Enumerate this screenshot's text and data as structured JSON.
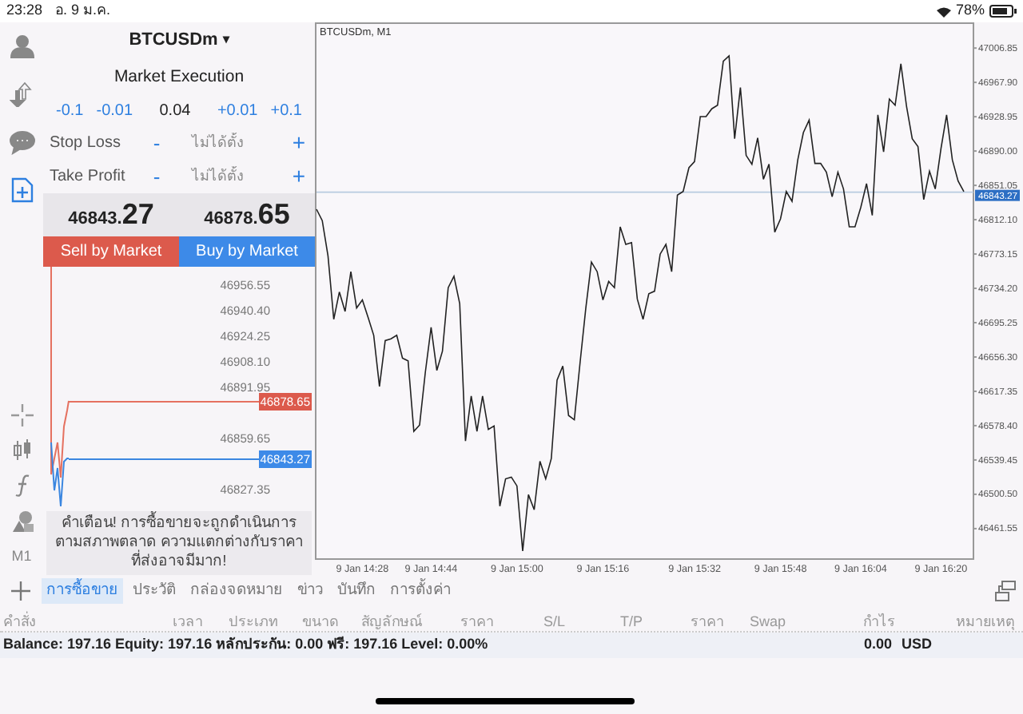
{
  "status_bar": {
    "time": "23:28",
    "date": "อ. 9 ม.ค.",
    "battery": "78%"
  },
  "sidebar": [
    {
      "selected": false
    },
    {
      "selected": false
    },
    {
      "selected": false
    },
    {
      "selected": true
    }
  ],
  "timeframe": "M1",
  "order_panel": {
    "symbol": "BTCUSDm",
    "symbol_caret": "▾",
    "execution": "Market Execution",
    "volume": {
      "steps_down": [
        "-0.1",
        "-0.01"
      ],
      "value": "0.04",
      "steps_up": [
        "+0.01",
        "+0.1"
      ]
    },
    "levels": [
      {
        "label": "Stop Loss",
        "minus": "-",
        "placeholder": "ไม่ได้ตั้ง",
        "plus": "+"
      },
      {
        "label": "Take Profit",
        "minus": "-",
        "placeholder": "ไม่ได้ตั้ง",
        "plus": "+"
      }
    ],
    "bid": "46843.27",
    "ask": "46878.65",
    "buttons": [
      {
        "label": "Sell by Market",
        "kind": "sell"
      },
      {
        "label": "Buy by Market",
        "kind": "buy"
      }
    ],
    "mini_chart": {
      "price_labels": [
        "46956.55",
        "46940.40",
        "46924.25",
        "46908.10",
        "46891.95",
        "46859.65",
        "46827.35"
      ],
      "ask_tag": "46878.65",
      "bid_tag": "46843.27"
    },
    "warning": "คำเตือน! การซื้อขายจะถูกดำเนินการตามสภาพตลาด ความแตกต่างกับราคาที่ส่งอาจมีมาก!"
  },
  "chart": {
    "chart_data": {
      "type": "line",
      "ref_lines": [
        {
          "axis": "y",
          "value": 46843.27,
          "label": "46843.27"
        }
      ],
      "title": "BTCUSDm, M1",
      "ylim": [
        46427,
        47036
      ],
      "yticks": [
        {
          "value": 47006.85,
          "label": "47006.85"
        },
        {
          "value": 46967.9,
          "label": "46967.90"
        },
        {
          "value": 46928.95,
          "label": "46928.95"
        },
        {
          "value": 46890,
          "label": "46890.00"
        },
        {
          "value": 46851.05,
          "label": "46851.05"
        },
        {
          "value": 46812.1,
          "label": "46812.10"
        },
        {
          "value": 46773.15,
          "label": "46773.15"
        },
        {
          "value": 46734.2,
          "label": "46734.20"
        },
        {
          "value": 46695.25,
          "label": "46695.25"
        },
        {
          "value": 46656.3,
          "label": "46656.30"
        },
        {
          "value": 46617.35,
          "label": "46617.35"
        },
        {
          "value": 46578.4,
          "label": "46578.40"
        },
        {
          "value": 46539.45,
          "label": "46539.45"
        },
        {
          "value": 46500.5,
          "label": "46500.50"
        },
        {
          "value": 46461.55,
          "label": "46461.55"
        }
      ],
      "categories": [
        null,
        null,
        null,
        null,
        null,
        null,
        null,
        null,
        "9 Jan 14:28",
        null,
        null,
        null,
        null,
        null,
        null,
        null,
        null,
        null,
        null,
        null,
        "9 Jan 14:44",
        null,
        null,
        null,
        null,
        null,
        null,
        null,
        null,
        null,
        null,
        null,
        null,
        null,
        null,
        "9 Jan 15:00",
        null,
        null,
        null,
        null,
        null,
        null,
        null,
        null,
        null,
        null,
        null,
        null,
        null,
        null,
        "9 Jan 15:16",
        null,
        null,
        null,
        null,
        null,
        null,
        null,
        null,
        null,
        null,
        null,
        null,
        null,
        null,
        null,
        "9 Jan 15:32",
        null,
        null,
        null,
        null,
        null,
        null,
        null,
        null,
        null,
        null,
        null,
        null,
        null,
        null,
        "9 Jan 15:48",
        null,
        null,
        null,
        null,
        null,
        null,
        null,
        null,
        null,
        null,
        null,
        null,
        null,
        "9 Jan 16:04",
        null,
        null,
        null,
        null,
        null,
        null,
        null,
        null,
        null,
        null,
        null,
        null,
        null,
        "9 Jan 16:20",
        null,
        null,
        null,
        null
      ],
      "series": [
        {
          "color": "#222222",
          "values": [
            46824,
            46811,
            46771,
            46699,
            46730,
            46708,
            46753,
            46712,
            46721,
            46701,
            46681,
            46623,
            46675,
            46677,
            46681,
            46655,
            46652,
            46572,
            46579,
            46639,
            46690,
            46641,
            46663,
            46735,
            46748,
            46717,
            46561,
            46612,
            46572,
            46612,
            46574,
            46578,
            46487,
            46518,
            46520,
            46510,
            46436,
            46500,
            46483,
            46538,
            46518,
            46541,
            46630,
            46646,
            46590,
            46585,
            46650,
            46712,
            46764,
            46753,
            46721,
            46742,
            46735,
            46804,
            46784,
            46786,
            46722,
            46699,
            46728,
            46731,
            46773,
            46784,
            46753,
            46840,
            46844,
            46871,
            46878,
            46929,
            46929,
            46938,
            46942,
            46992,
            46998,
            46904,
            46962,
            46885,
            46875,
            46905,
            46858,
            46875,
            46798,
            46813,
            46844,
            46833,
            46880,
            46911,
            46925,
            46876,
            46876,
            46866,
            46838,
            46866,
            46847,
            46804,
            46804,
            46826,
            46853,
            46817,
            46931,
            46889,
            46949,
            46942,
            46989,
            46940,
            46904,
            46895,
            46835,
            46867,
            46847,
            46893,
            46931,
            46880,
            46856,
            46844
          ]
        }
      ]
    }
  },
  "tabs": [
    {
      "label": "การซื้อขาย",
      "selected": true
    },
    {
      "label": "ประวัติ",
      "selected": false
    },
    {
      "label": "กล่องจดหมาย",
      "selected": false
    },
    {
      "label": "ข่าว",
      "selected": false
    },
    {
      "label": "บันทึก",
      "selected": false
    },
    {
      "label": "การตั้งค่า",
      "selected": false
    }
  ],
  "table": {
    "columns": [
      "คำสั่ง",
      "เวลา",
      "ประเภท",
      "ขนาด",
      "สัญลักษณ์",
      "ราคา",
      "S/L",
      "T/P",
      "ราคา",
      "Swap",
      "กำไร",
      "หมายเหตุ"
    ]
  },
  "summary": {
    "text": "Balance: 197.16 Equity: 197.16 หลักประกัน: 0.00 ฟรี: 197.16 Level: 0.00%",
    "profit": "0.00",
    "currency": "USD"
  }
}
